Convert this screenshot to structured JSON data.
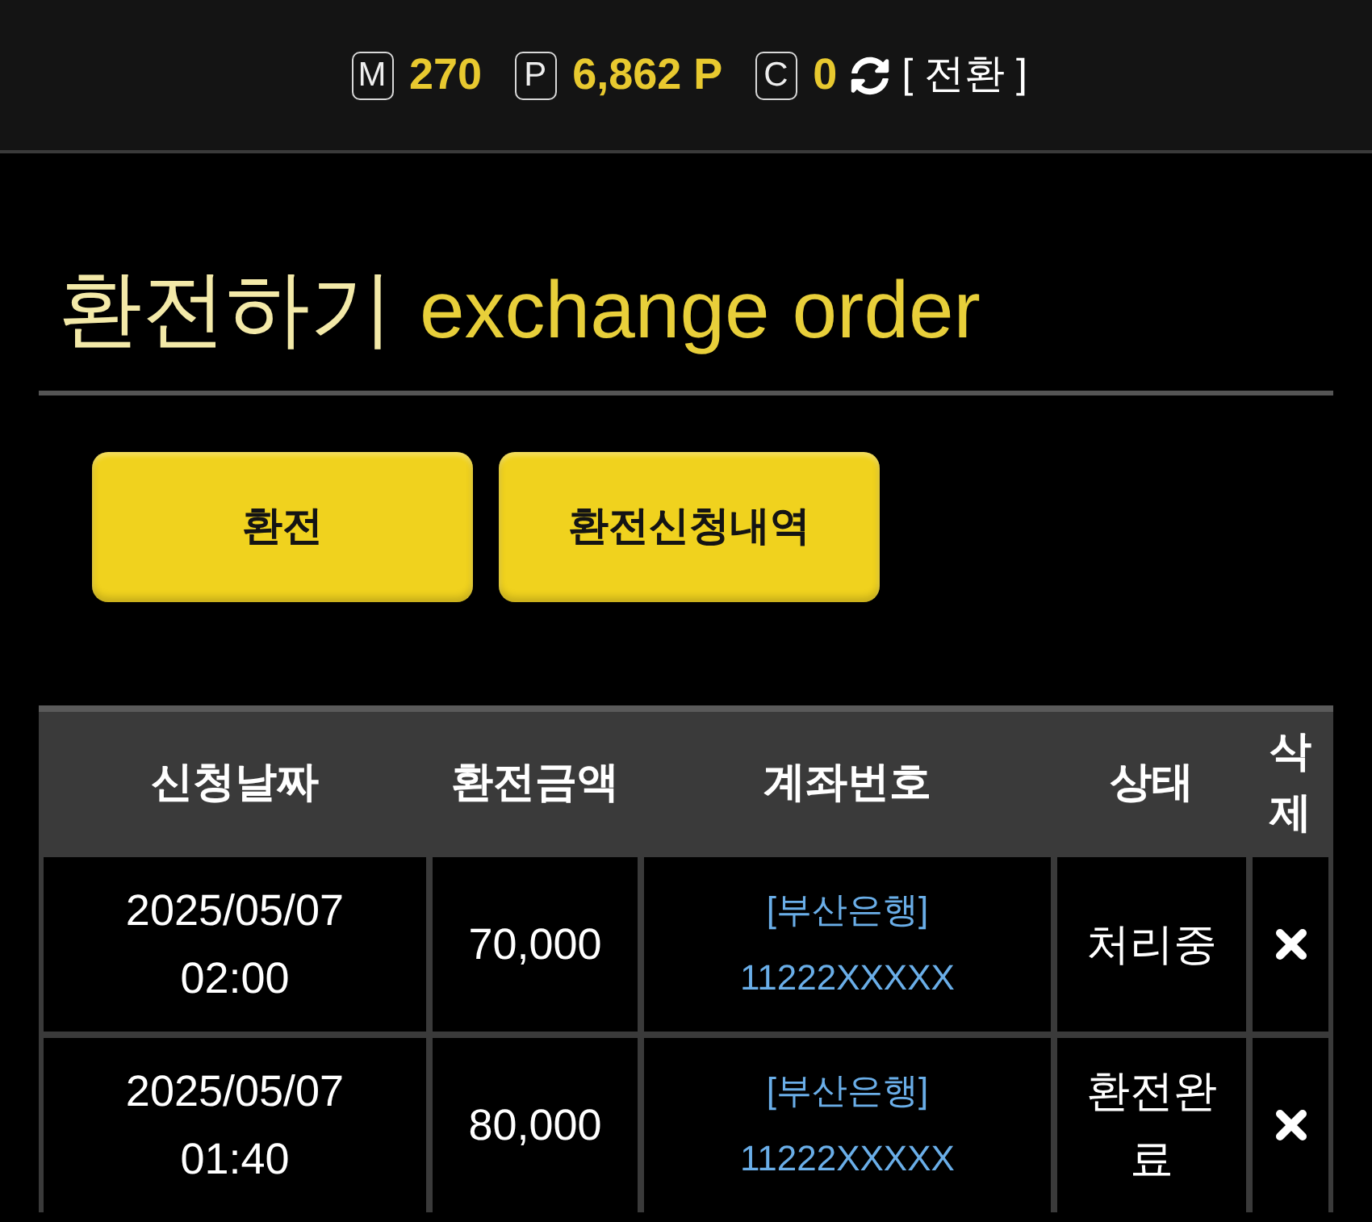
{
  "top_bar": {
    "balances": [
      {
        "symbol": "M",
        "amount": "270"
      },
      {
        "symbol": "P",
        "amount": "6,862 P"
      },
      {
        "symbol": "C",
        "amount": "0"
      }
    ],
    "switch_label": "[ 전환 ]"
  },
  "page_title": {
    "korean": "환전하기",
    "english": "exchange order"
  },
  "buttons": [
    {
      "label": "환전"
    },
    {
      "label": "환전신청내역"
    }
  ],
  "table": {
    "columns": [
      "신청날짜",
      "환전금액",
      "계좌번호",
      "상태",
      "삭제"
    ],
    "rows": [
      {
        "date": "2025/05/07",
        "time": "02:00",
        "amount": "70,000",
        "bank": "[부산은행]",
        "account": "11222XXXXX",
        "status": "처리중"
      },
      {
        "date": "2025/05/07",
        "time": "01:40",
        "amount": "80,000",
        "bank": "[부산은행]",
        "account": "11222XXXXX",
        "status": "환전완료"
      }
    ]
  }
}
